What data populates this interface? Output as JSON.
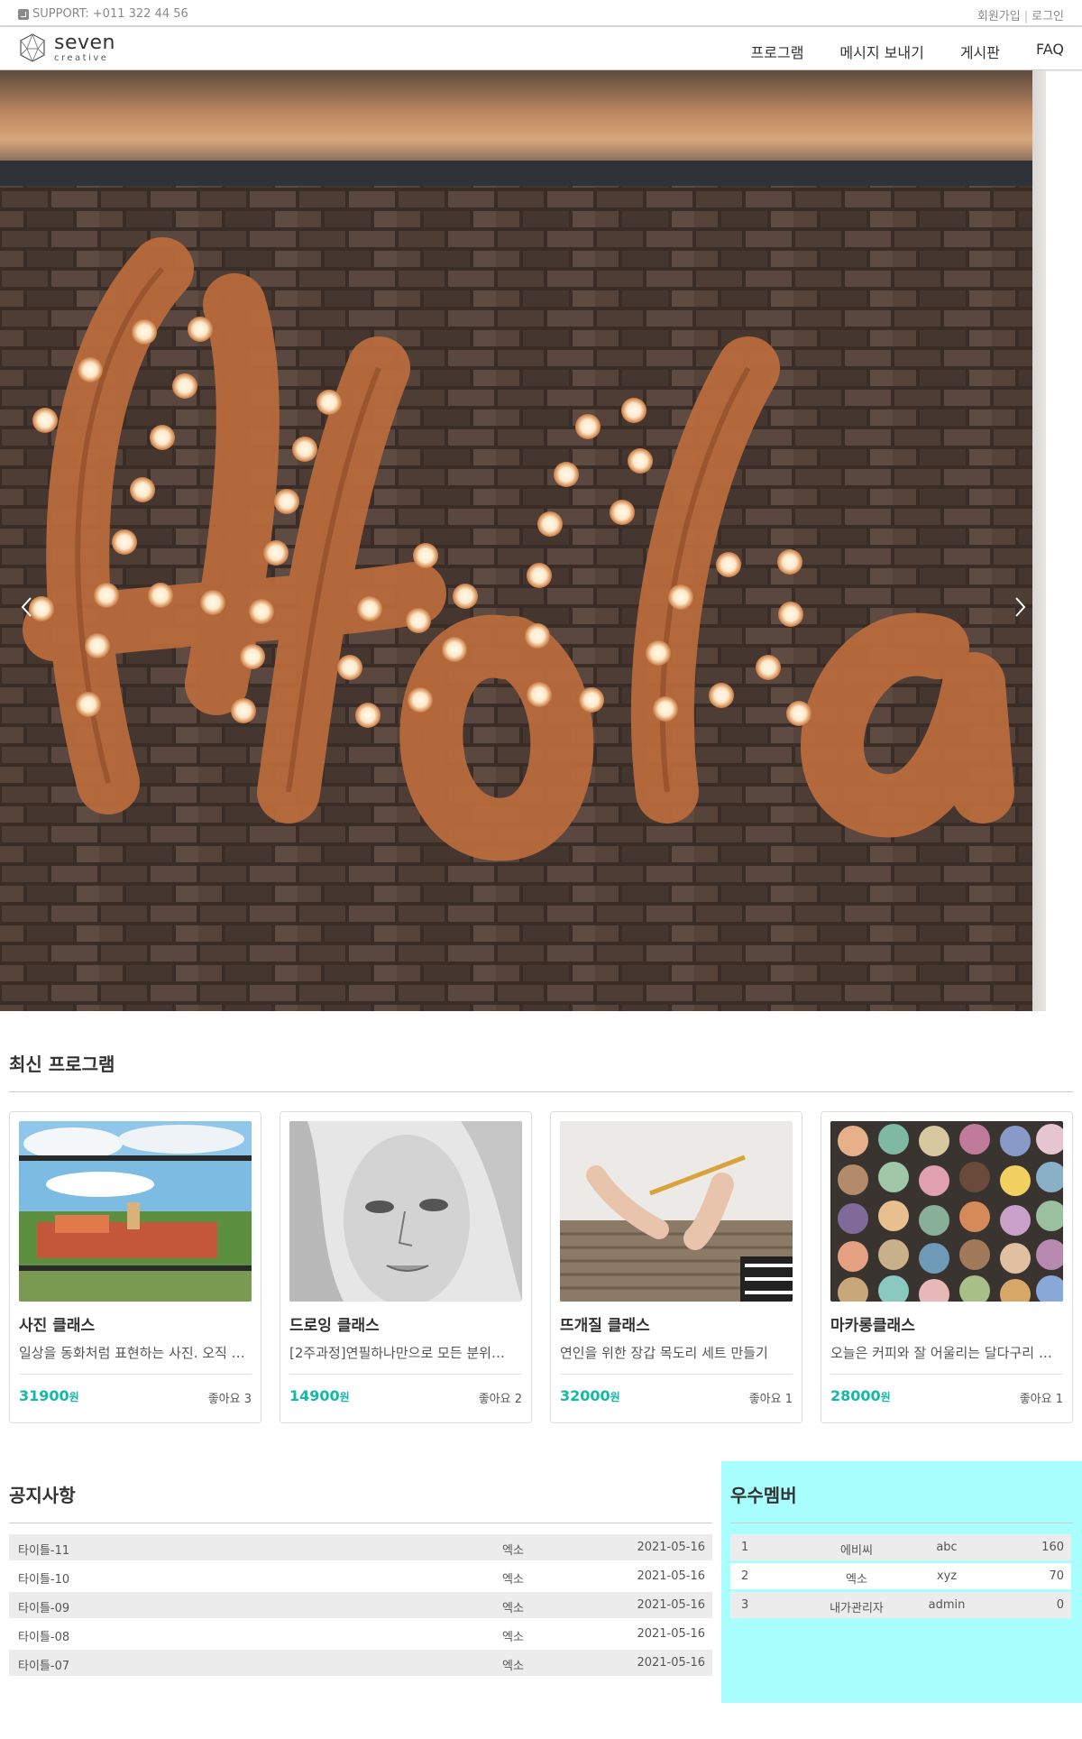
{
  "topbar": {
    "support": "SUPPORT: +011 322 44 56",
    "signup": "회원가입",
    "login": "로그인"
  },
  "header": {
    "logo_main": "seven",
    "logo_sub": "creative",
    "nav": [
      "프로그램",
      "메시지 보내기",
      "게시판",
      "FAQ"
    ]
  },
  "hero": {
    "image": "marquee-light-sign-hola-on-brick-wall",
    "prev_icon": "chevron-left-icon",
    "next_icon": "chevron-right-icon"
  },
  "programs": {
    "title": "최신 프로그램",
    "items": [
      {
        "name": "사진 클래스",
        "desc": "일상을 동화처럼 표현하는 사진. 오직 …",
        "price": "31900",
        "unit": "원",
        "likes": "좋아요 3",
        "image": "colorful-town-landscape-photo"
      },
      {
        "name": "드로잉 클래스",
        "desc": "[2주과정]연필하나만으로 모든 분위…",
        "price": "14900",
        "unit": "원",
        "likes": "좋아요 2",
        "image": "pencil-portrait-drawing"
      },
      {
        "name": "뜨개질 클래스",
        "desc": "연인을 위한 장갑 목도리 세트 만들기",
        "price": "32000",
        "unit": "원",
        "likes": "좋아요 1",
        "image": "crochet-knitting-hands"
      },
      {
        "name": "마카롱클래스",
        "desc": "오늘은 커피와 잘 어울리는 달다구리 …",
        "price": "28000",
        "unit": "원",
        "likes": "좋아요 1",
        "image": "macarons-box"
      }
    ]
  },
  "notice": {
    "title": "공지사항",
    "rows": [
      {
        "title": "타이틀-11",
        "author": "엑소",
        "date": "2021-05-16"
      },
      {
        "title": "타이틀-10",
        "author": "엑소",
        "date": "2021-05-16"
      },
      {
        "title": "타이틀-09",
        "author": "엑소",
        "date": "2021-05-16"
      },
      {
        "title": "타이틀-08",
        "author": "엑소",
        "date": "2021-05-16"
      },
      {
        "title": "타이틀-07",
        "author": "엑소",
        "date": "2021-05-16"
      }
    ]
  },
  "members": {
    "title": "우수멤버",
    "rows": [
      {
        "rank": "1",
        "name": "에비씨",
        "id": "abc",
        "score": "160"
      },
      {
        "rank": "2",
        "name": "엑소",
        "id": "xyz",
        "score": "70"
      },
      {
        "rank": "3",
        "name": "내가관리자",
        "id": "admin",
        "score": "0"
      }
    ]
  },
  "colors": {
    "accent_price": "#14b8a6",
    "members_bg": "#a8fffe",
    "row_shade": "#ececec"
  }
}
